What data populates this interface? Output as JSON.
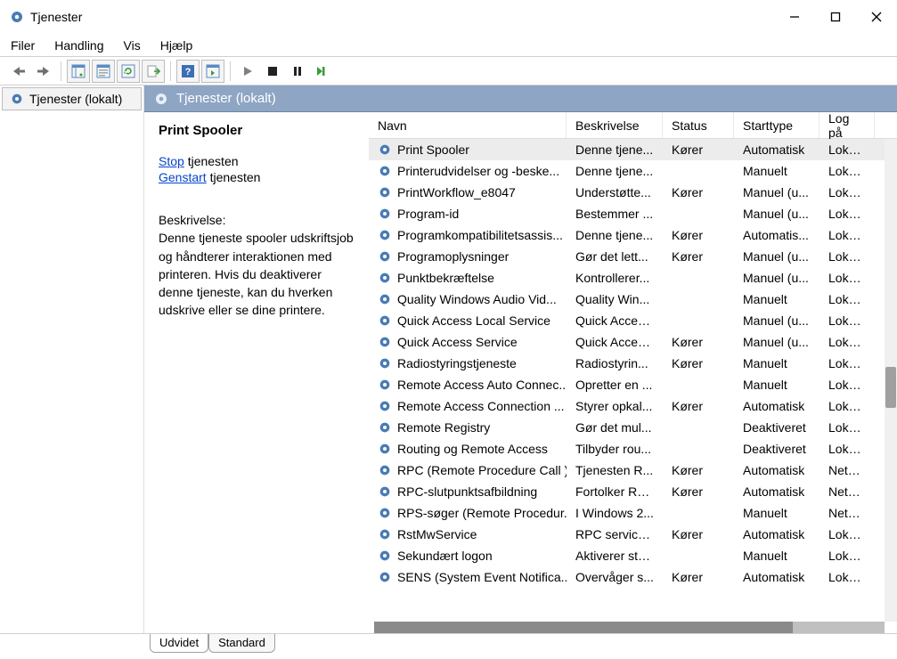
{
  "window": {
    "title": "Tjenester"
  },
  "menu": {
    "file": "Filer",
    "action": "Handling",
    "view": "Vis",
    "help": "Hjælp"
  },
  "tree": {
    "root": "Tjenester (lokalt)"
  },
  "pane": {
    "header": "Tjenester (lokalt)"
  },
  "detail": {
    "selected_name": "Print Spooler",
    "stop_link": "Stop",
    "stop_suffix": " tjenesten",
    "restart_link": "Genstart",
    "restart_suffix": " tjenesten",
    "desc_label": "Beskrivelse:",
    "desc_text": "Denne tjeneste spooler udskriftsjob og håndterer interaktionen med printeren. Hvis du deaktiverer denne tjeneste, kan du hverken udskrive eller se dine printere."
  },
  "columns": {
    "name": "Navn",
    "desc": "Beskrivelse",
    "status": "Status",
    "start": "Starttype",
    "logon": "Log på"
  },
  "rows": [
    {
      "name": "Print Spooler",
      "desc": "Denne tjene...",
      "status": "Kører",
      "start": "Automatisk",
      "logon": "Lokalt s",
      "selected": true
    },
    {
      "name": "Printerudvidelser og -beske...",
      "desc": "Denne tjene...",
      "status": "",
      "start": "Manuelt",
      "logon": "Lokalt s"
    },
    {
      "name": "PrintWorkflow_e8047",
      "desc": "Understøtte...",
      "status": "Kører",
      "start": "Manuel (u...",
      "logon": "Lokalt s"
    },
    {
      "name": "Program-id",
      "desc": "Bestemmer ...",
      "status": "",
      "start": "Manuel (u...",
      "logon": "Lokal tj"
    },
    {
      "name": "Programkompatibilitetsassis...",
      "desc": "Denne tjene...",
      "status": "Kører",
      "start": "Automatis...",
      "logon": "Lokalt s"
    },
    {
      "name": "Programoplysninger",
      "desc": "Gør det lett...",
      "status": "Kører",
      "start": "Manuel (u...",
      "logon": "Lokalt s"
    },
    {
      "name": "Punktbekræftelse",
      "desc": "Kontrollerer...",
      "status": "",
      "start": "Manuel (u...",
      "logon": "Lokalt s"
    },
    {
      "name": "Quality Windows Audio Vid...",
      "desc": "Quality Win...",
      "status": "",
      "start": "Manuelt",
      "logon": "Lokal tj"
    },
    {
      "name": "Quick Access Local Service",
      "desc": "Quick Acces...",
      "status": "",
      "start": "Manuel (u...",
      "logon": "Lokal tj"
    },
    {
      "name": "Quick Access Service",
      "desc": "Quick Acces...",
      "status": "Kører",
      "start": "Manuel (u...",
      "logon": "Lokalt s"
    },
    {
      "name": "Radiostyringstjeneste",
      "desc": "Radiostyrin...",
      "status": "Kører",
      "start": "Manuelt",
      "logon": "Lokal tj"
    },
    {
      "name": "Remote Access Auto Connec...",
      "desc": "Opretter en ...",
      "status": "",
      "start": "Manuelt",
      "logon": "Lokalt s"
    },
    {
      "name": "Remote Access Connection ...",
      "desc": "Styrer opkal...",
      "status": "Kører",
      "start": "Automatisk",
      "logon": "Lokalt s"
    },
    {
      "name": "Remote Registry",
      "desc": "Gør det mul...",
      "status": "",
      "start": "Deaktiveret",
      "logon": "Lokal tj"
    },
    {
      "name": "Routing og Remote Access",
      "desc": "Tilbyder rou...",
      "status": "",
      "start": "Deaktiveret",
      "logon": "Lokalt s"
    },
    {
      "name": "RPC (Remote Procedure Call )",
      "desc": "Tjenesten R...",
      "status": "Kører",
      "start": "Automatisk",
      "logon": "Netvær"
    },
    {
      "name": "RPC-slutpunktsafbildning",
      "desc": "Fortolker RP...",
      "status": "Kører",
      "start": "Automatisk",
      "logon": "Netvær"
    },
    {
      "name": "RPS-søger (Remote Procedur...",
      "desc": "I Windows 2...",
      "status": "",
      "start": "Manuelt",
      "logon": "Netvær"
    },
    {
      "name": "RstMwService",
      "desc": "RPC service, ...",
      "status": "Kører",
      "start": "Automatisk",
      "logon": "Lokalt s"
    },
    {
      "name": "Sekundært logon",
      "desc": "Aktiverer sta...",
      "status": "",
      "start": "Manuelt",
      "logon": "Lokalt s"
    },
    {
      "name": "SENS (System Event Notifica...",
      "desc": "Overvåger s...",
      "status": "Kører",
      "start": "Automatisk",
      "logon": "Lokalt s"
    }
  ],
  "tabs": {
    "extended": "Udvidet",
    "standard": "Standard"
  }
}
